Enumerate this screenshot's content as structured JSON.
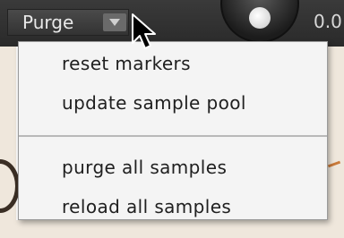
{
  "header": {
    "purge_label": "Purge",
    "value_readout": "0.0"
  },
  "menu": {
    "items": [
      {
        "label": "reset markers"
      },
      {
        "label": "update sample pool"
      },
      {
        "label": "purge all samples"
      },
      {
        "label": "reload all samples"
      }
    ]
  },
  "icons": {
    "dropdown": "chevron-down-icon",
    "cursor": "mouse-pointer-icon",
    "knob": "rotary-knob"
  },
  "colors": {
    "topbar": "#2f2f2f",
    "menu_bg": "#f4f4f4",
    "menu_text": "#202020",
    "accent_orange": "#c97a3a"
  }
}
